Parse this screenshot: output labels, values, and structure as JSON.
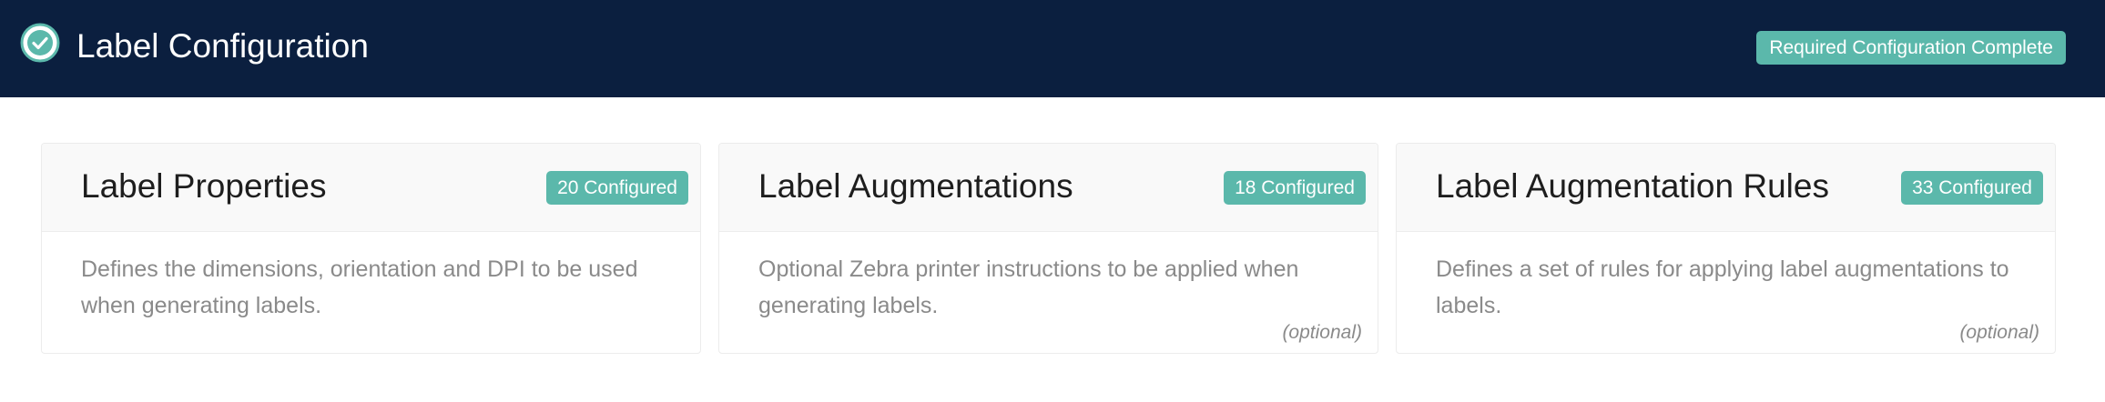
{
  "header": {
    "title": "Label Configuration",
    "icon": "check-circle-icon",
    "status_badge": "Required Configuration Complete"
  },
  "cards": [
    {
      "title": "Label Properties",
      "badge": "20 Configured",
      "description": "Defines the dimensions, orientation and DPI to be used when generating labels.",
      "optional": ""
    },
    {
      "title": "Label Augmentations",
      "badge": "18 Configured",
      "description": "Optional Zebra printer instructions to be applied when generating labels.",
      "optional": "(optional)"
    },
    {
      "title": "Label Augmentation Rules",
      "badge": "33 Configured",
      "description": "Defines a set of rules for applying label augmentations to labels.",
      "optional": "(optional)"
    }
  ],
  "colors": {
    "header_bg": "#0b1f3f",
    "accent": "#5bb8ab",
    "card_head_bg": "#f9f9f9",
    "muted_text": "#8a8a8a"
  }
}
